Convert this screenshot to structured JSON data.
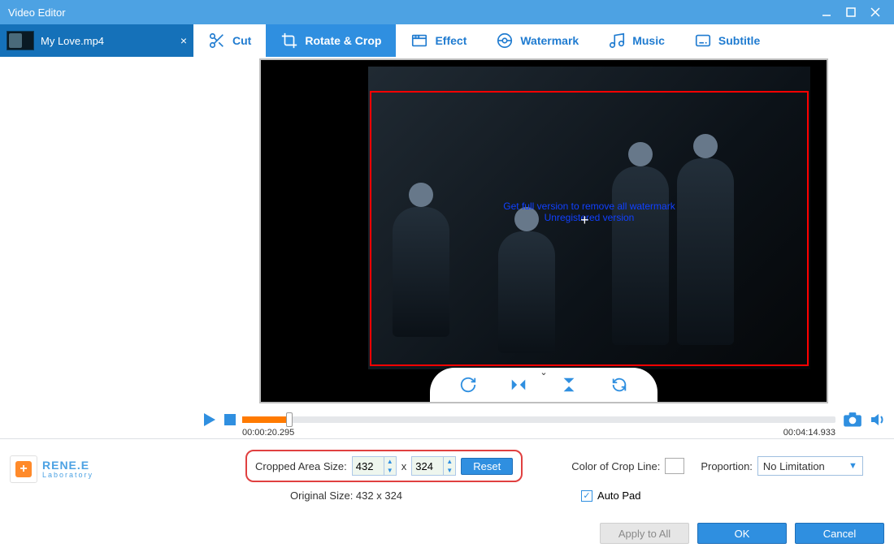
{
  "window": {
    "title": "Video Editor"
  },
  "file_tab": {
    "name": "My Love.mp4"
  },
  "tabs": {
    "cut": "Cut",
    "rotate_crop": "Rotate & Crop",
    "effect": "Effect",
    "watermark": "Watermark",
    "music": "Music",
    "subtitle": "Subtitle"
  },
  "watermark_overlay": {
    "line1": "Get full version to remove all watermark",
    "line2": "Unregistered version"
  },
  "timeline": {
    "current": "00:00:20.295",
    "duration": "00:04:14.933"
  },
  "crop": {
    "label": "Cropped Area Size:",
    "width": "432",
    "height": "324",
    "reset": "Reset",
    "original_label": "Original Size: 432 x 324"
  },
  "cropline": {
    "label": "Color of Crop Line:"
  },
  "proportion": {
    "label": "Proportion:",
    "value": "No Limitation"
  },
  "autopad": {
    "label": "Auto Pad"
  },
  "logo": {
    "brand": "RENE.E",
    "sub": "Laboratory"
  },
  "buttons": {
    "apply_all": "Apply to All",
    "ok": "OK",
    "cancel": "Cancel"
  }
}
